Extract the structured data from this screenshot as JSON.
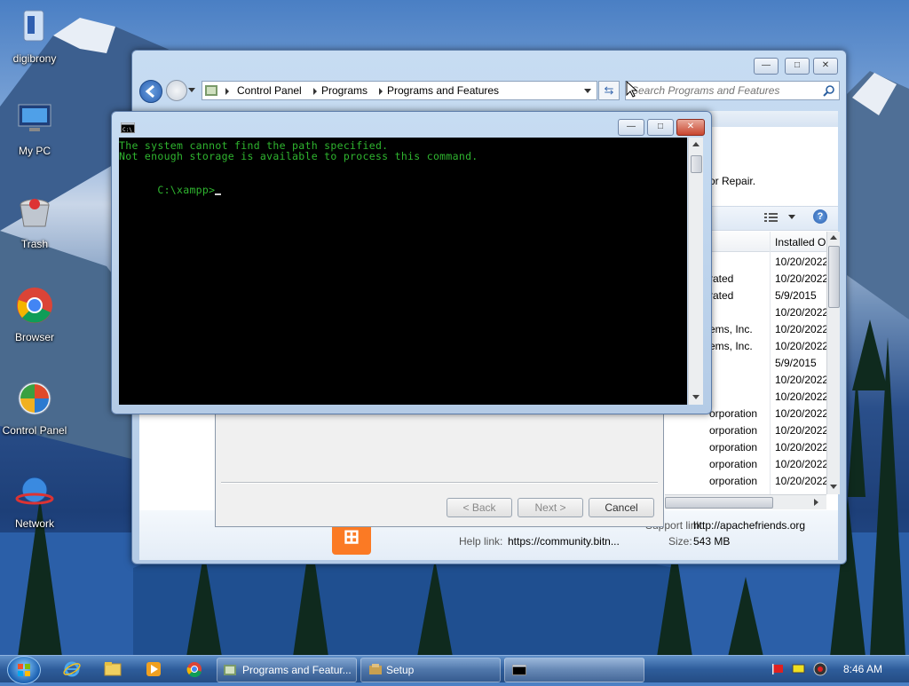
{
  "desktop": {
    "icons": [
      {
        "label": "digibrony",
        "icon": "user-folder-icon"
      },
      {
        "label": "My PC",
        "icon": "computer-icon"
      },
      {
        "label": "Trash",
        "icon": "trash-icon"
      },
      {
        "label": "Browser",
        "icon": "chrome-icon"
      },
      {
        "label": "Control Panel",
        "icon": "control-panel-icon"
      },
      {
        "label": "Network",
        "icon": "network-icon"
      }
    ]
  },
  "explorer": {
    "breadcrumb": [
      "Control Panel",
      "Programs",
      "Programs and Features"
    ],
    "search_placeholder": "Search Programs and Features",
    "partial_text": "or Repair.",
    "column_installed": "Installed O",
    "rows": [
      {
        "publisher": "",
        "date": "10/20/2022"
      },
      {
        "publisher": "rated",
        "date": "10/20/2022"
      },
      {
        "publisher": "rated",
        "date": "5/9/2015"
      },
      {
        "publisher": "",
        "date": "10/20/2022"
      },
      {
        "publisher": "ems, Inc.",
        "date": "10/20/2022"
      },
      {
        "publisher": "ems, Inc.",
        "date": "10/20/2022"
      },
      {
        "publisher": "",
        "date": "5/9/2015"
      },
      {
        "publisher": "",
        "date": "10/20/2022"
      },
      {
        "publisher": "",
        "date": "10/20/2022"
      },
      {
        "publisher": "orporation",
        "date": "10/20/2022"
      },
      {
        "publisher": "orporation",
        "date": "10/20/2022"
      },
      {
        "publisher": "orporation",
        "date": "10/20/2022"
      },
      {
        "publisher": "orporation",
        "date": "10/20/2022"
      },
      {
        "publisher": "orporation",
        "date": "10/20/2022"
      }
    ],
    "details": {
      "support_label": "Support link:",
      "support_value": "http://apachefriends.org",
      "help_label": "Help link:",
      "help_value": "https://community.bitn...",
      "size_label": "Size:",
      "size_value": "543 MB"
    }
  },
  "setup": {
    "back_label": "< Back",
    "next_label": "Next >",
    "cancel_label": "Cancel"
  },
  "cmd": {
    "lines": [
      "The system cannot find the path specified.",
      "Not enough storage is available to process this command.",
      "",
      "C:\\xampp>"
    ],
    "text_color": "#2fb52f"
  },
  "taskbar": {
    "items": [
      {
        "label": "Programs and Featur..."
      },
      {
        "label": "Setup"
      },
      {
        "label": ""
      }
    ],
    "clock": "8:46 AM"
  }
}
